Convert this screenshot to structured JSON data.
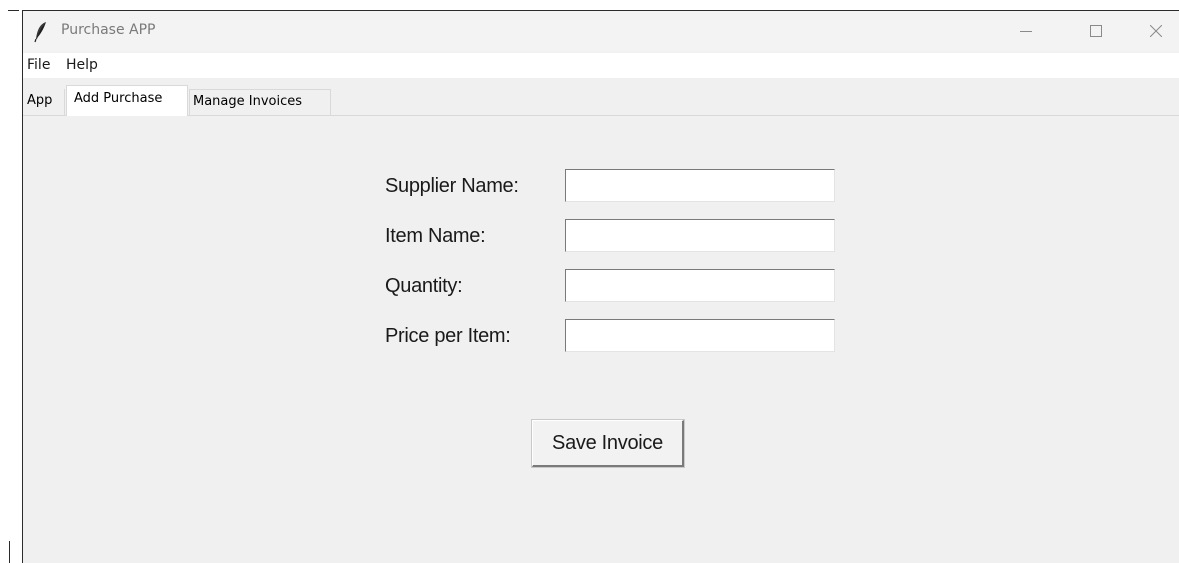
{
  "window": {
    "title": "Purchase APP"
  },
  "menubar": {
    "file_label": "File",
    "help_label": "Help"
  },
  "tabs": [
    {
      "label": "App",
      "selected": false
    },
    {
      "label": "Add Purchase",
      "selected": true
    },
    {
      "label": "Manage Invoices",
      "selected": false
    }
  ],
  "form": {
    "supplier_name": {
      "label": "Supplier Name:",
      "value": ""
    },
    "item_name": {
      "label": "Item Name:",
      "value": ""
    },
    "quantity": {
      "label": "Quantity:",
      "value": ""
    },
    "price_per_item": {
      "label": "Price per Item:",
      "value": ""
    }
  },
  "actions": {
    "save_label": "Save Invoice"
  },
  "icons": {
    "app": "feather-icon",
    "minimize": "minimize-icon",
    "maximize": "maximize-icon",
    "close": "close-icon"
  }
}
